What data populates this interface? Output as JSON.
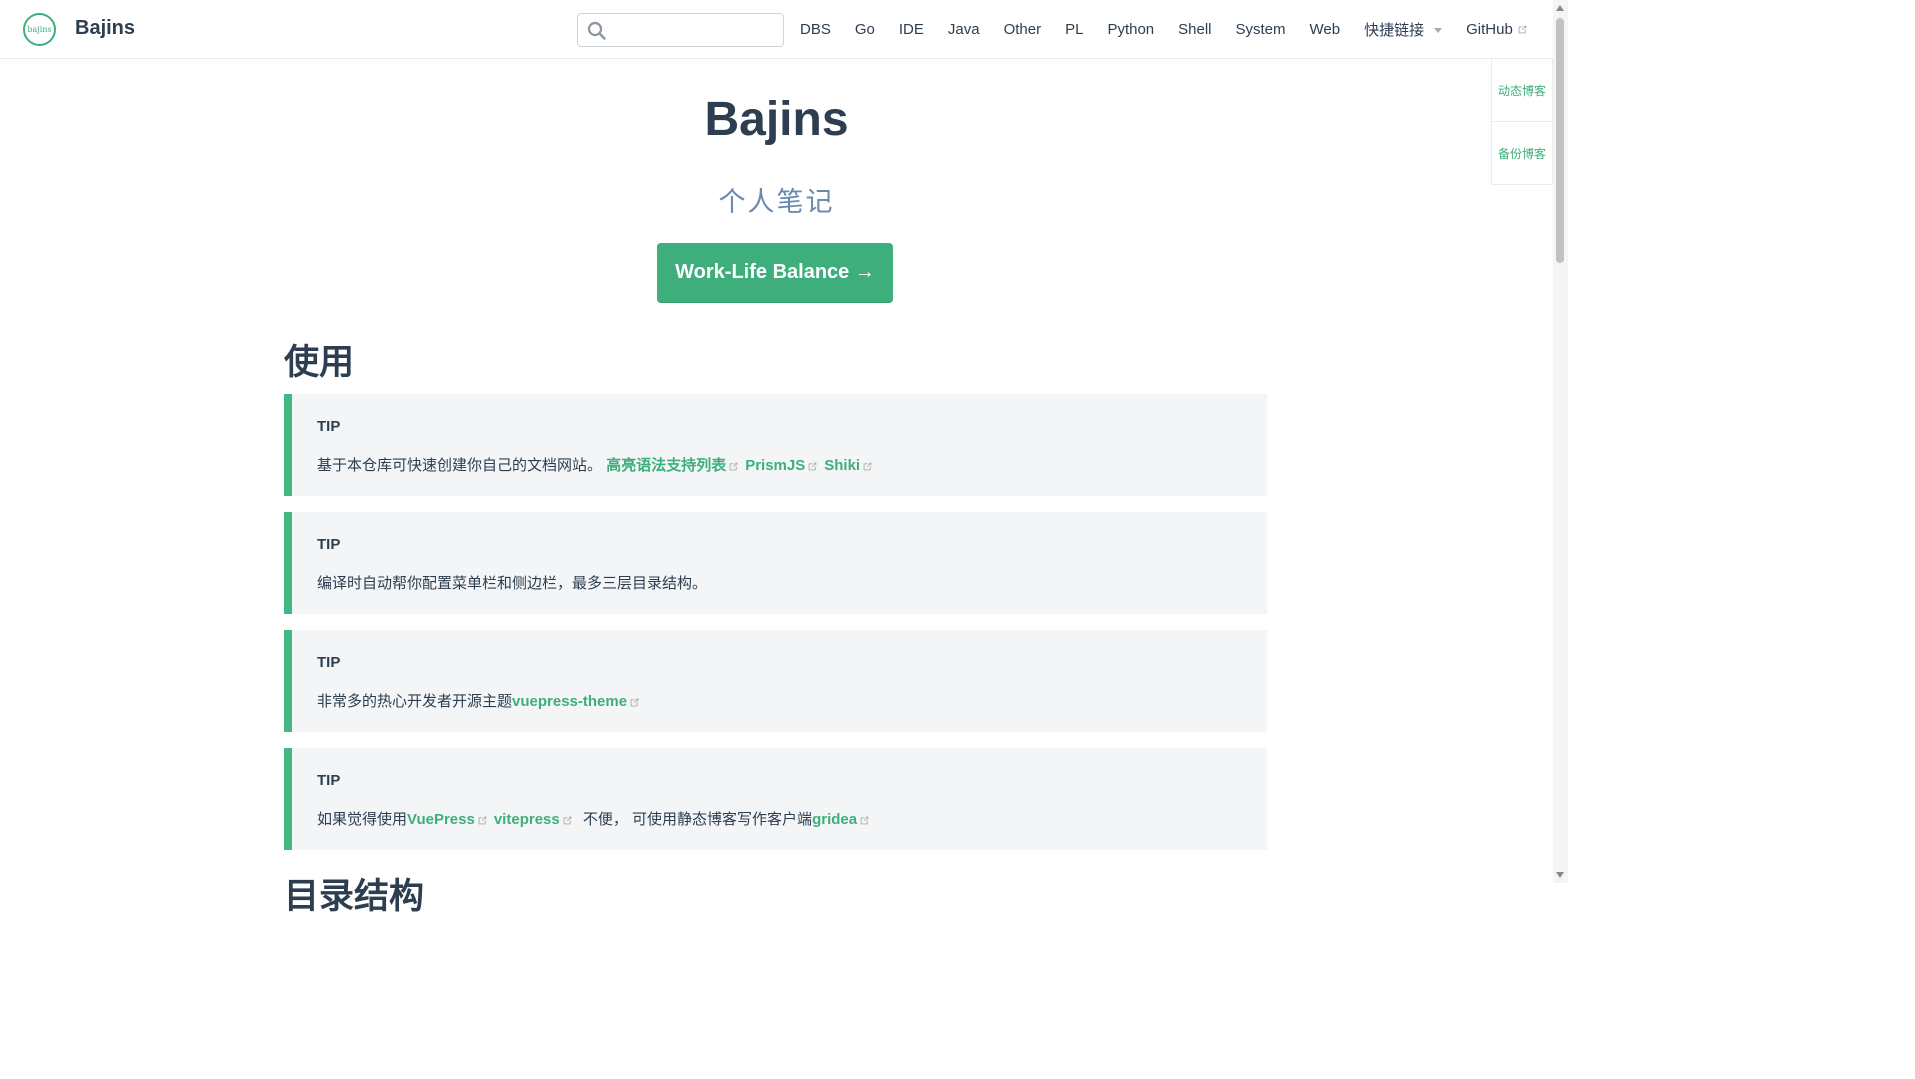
{
  "navbar": {
    "logo_text": "bajins",
    "site_name": "Bajins",
    "search_placeholder": "",
    "links": [
      {
        "label": "DBS"
      },
      {
        "label": "Go"
      },
      {
        "label": "IDE"
      },
      {
        "label": "Java"
      },
      {
        "label": "Other"
      },
      {
        "label": "PL"
      },
      {
        "label": "Python"
      },
      {
        "label": "Shell"
      },
      {
        "label": "System"
      },
      {
        "label": "Web"
      }
    ],
    "dropdown_label": "快捷链接",
    "github_label": "GitHub"
  },
  "side_panel": {
    "items": [
      {
        "label": "动态博客"
      },
      {
        "label": "备份博客"
      }
    ]
  },
  "hero": {
    "title": "Bajins",
    "description": "个人笔记",
    "action_label": "Work-Life Balance →"
  },
  "content": {
    "section_title": "使用",
    "section_title_2": "目录结构",
    "tips": [
      {
        "title": "TIP",
        "text": "基于本仓库可快速创建你自己的文档网站。",
        "links": [
          "高亮语法支持列表",
          "PrismJS",
          "Shiki"
        ]
      },
      {
        "title": "TIP",
        "text": "编译时自动帮你配置菜单栏和侧边栏，最多三层目录结构。"
      },
      {
        "title": "TIP",
        "text": "非常多的热心开发者开源主题",
        "link": "vuepress-theme"
      },
      {
        "title": "TIP",
        "text_before": "如果觉得使用",
        "link1": "VuePress",
        "link2": "vitepress",
        "text_middle": " 不便， 可使用静态博客写作客户端",
        "link3": "gridea"
      }
    ]
  },
  "colors": {
    "accent": "#3eaf7c",
    "text": "#2c3e50",
    "tip_bg": "#f3f5f7",
    "tip_border": "#42b983"
  }
}
